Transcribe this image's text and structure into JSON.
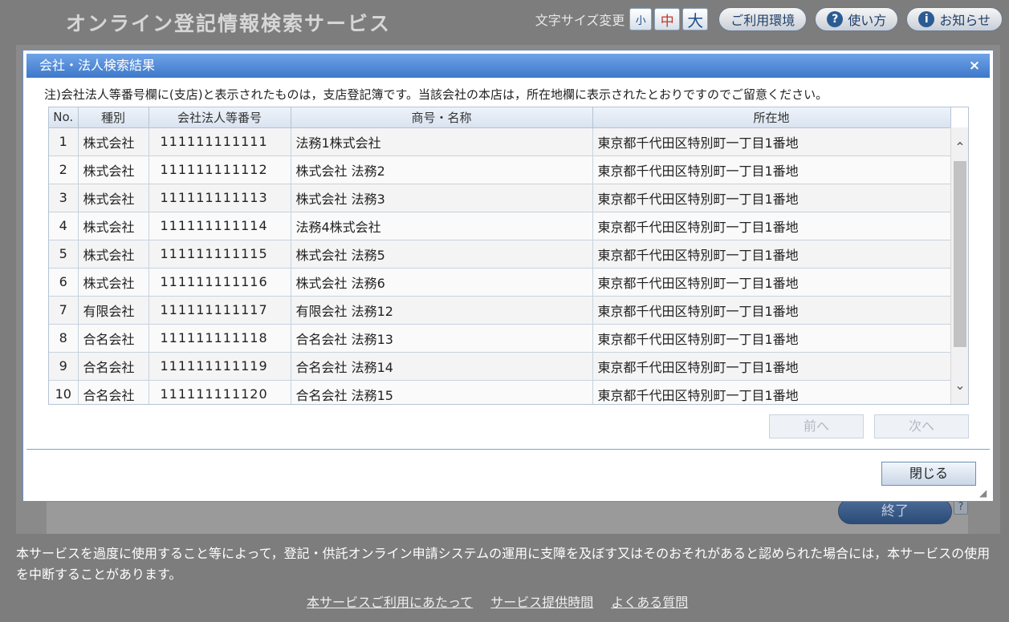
{
  "header": {
    "app_title": "オンライン登記情報検索サービス",
    "font_size_label": "文字サイズ変更",
    "font_small": "小",
    "font_medium": "中",
    "font_large": "大",
    "env_label": "ご利用環境",
    "howto_label": "使い方",
    "news_label": "お知らせ",
    "howto_icon_glyph": "?",
    "news_icon_glyph": "i"
  },
  "background": {
    "end_label": "終了",
    "help_glyph": "?"
  },
  "modal": {
    "title": "会社・法人検索結果",
    "close_glyph": "×",
    "notice": "注)会社法人等番号欄に(支店)と表示されたものは，支店登記簿です。当該会社の本店は，所在地欄に表示されたとおりですのでご留意ください。",
    "columns": [
      "No.",
      "種別",
      "会社法人等番号",
      "商号・名称",
      "所在地"
    ],
    "rows": [
      {
        "no": "1",
        "type": "株式会社",
        "number": "111111111111",
        "name": "法務1株式会社",
        "address": "東京都千代田区特別町一丁目1番地"
      },
      {
        "no": "2",
        "type": "株式会社",
        "number": "111111111112",
        "name": "株式会社 法務2",
        "address": "東京都千代田区特別町一丁目1番地"
      },
      {
        "no": "3",
        "type": "株式会社",
        "number": "111111111113",
        "name": "株式会社 法務3",
        "address": "東京都千代田区特別町一丁目1番地"
      },
      {
        "no": "4",
        "type": "株式会社",
        "number": "111111111114",
        "name": "法務4株式会社",
        "address": "東京都千代田区特別町一丁目1番地"
      },
      {
        "no": "5",
        "type": "株式会社",
        "number": "111111111115",
        "name": "株式会社 法務5",
        "address": "東京都千代田区特別町一丁目1番地"
      },
      {
        "no": "6",
        "type": "株式会社",
        "number": "111111111116",
        "name": "株式会社 法務6",
        "address": "東京都千代田区特別町一丁目1番地"
      },
      {
        "no": "7",
        "type": "有限会社",
        "number": "111111111117",
        "name": "有限会社 法務12",
        "address": "東京都千代田区特別町一丁目1番地"
      },
      {
        "no": "8",
        "type": "合名会社",
        "number": "111111111118",
        "name": "合名会社 法務13",
        "address": "東京都千代田区特別町一丁目1番地"
      },
      {
        "no": "9",
        "type": "合名会社",
        "number": "111111111119",
        "name": "合名会社 法務14",
        "address": "東京都千代田区特別町一丁目1番地"
      },
      {
        "no": "10",
        "type": "合名会社",
        "number": "111111111120",
        "name": "合名会社 法務15",
        "address": "東京都千代田区特別町一丁目1番地"
      }
    ],
    "prev_label": "前へ",
    "next_label": "次へ",
    "close_label": "閉じる"
  },
  "footer": {
    "text": "本サービスを過度に使用すること等によって，登記・供託オンライン申請システムの運用に支障を及ぼす又はそのおそれがあると認められた場合には，本サービスの使用を中断することがあります。",
    "links": [
      "本サービスご利用にあたって",
      "サービス提供時間",
      "よくある質問"
    ]
  },
  "colors": {
    "titlebar": "#3d78c9",
    "page_background": "#7d7d7d",
    "disabled_text": "#b3b9c2"
  }
}
